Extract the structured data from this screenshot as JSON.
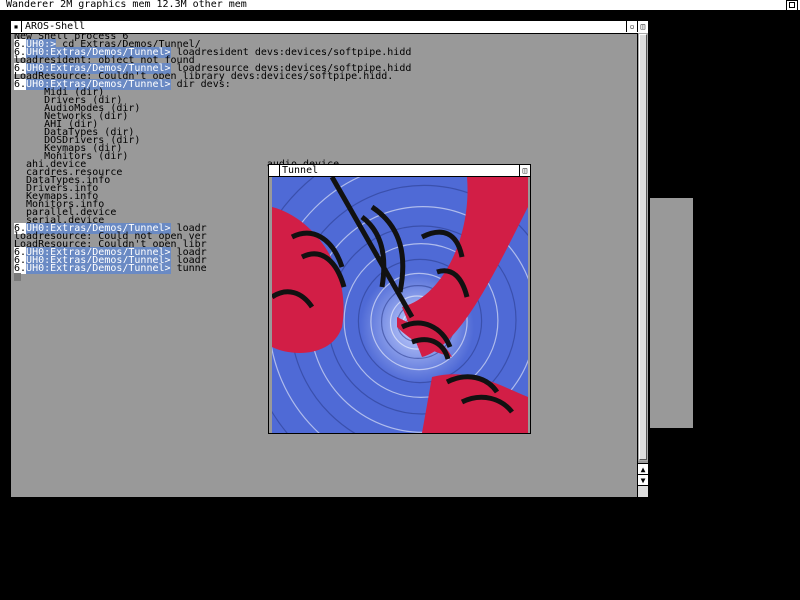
{
  "screen": {
    "title": "Wanderer 2M graphics mem 12.3M other mem"
  },
  "shell": {
    "title": "AROS-Shell",
    "close_glyph": "▪",
    "zoom_glyph": "▫",
    "depth_glyph": "◫",
    "up_glyph": "▲",
    "down_glyph": "▼",
    "lines": [
      {
        "type": "text",
        "text": "New Shell process 6"
      },
      {
        "type": "cmd",
        "num": "6.",
        "path": "UH0:>",
        "cmd": " cd Extras/Demos/Tunnel/"
      },
      {
        "type": "cmd",
        "num": "6.",
        "path": "UH0:Extras/Demos/Tunnel>",
        "cmd": " loadresident devs:devices/softpipe.hidd"
      },
      {
        "type": "text",
        "text": "loadresident: object not found"
      },
      {
        "type": "cmd",
        "num": "6.",
        "path": "UH0:Extras/Demos/Tunnel>",
        "cmd": " loadresource devs:devices/softpipe.hidd"
      },
      {
        "type": "text",
        "text": "LoadResource: Couldn't open library devs:devices/softpipe.hidd."
      },
      {
        "type": "cmd",
        "num": "6.",
        "path": "UH0:Extras/Demos/Tunnel>",
        "cmd": " dir devs:"
      },
      {
        "type": "text",
        "text": "     Midi (dir)"
      },
      {
        "type": "text",
        "text": "     Drivers (dir)"
      },
      {
        "type": "text",
        "text": "     AudioModes (dir)"
      },
      {
        "type": "text",
        "text": "     Networks (dir)"
      },
      {
        "type": "text",
        "text": "     AHI (dir)"
      },
      {
        "type": "text",
        "text": "     DataTypes (dir)"
      },
      {
        "type": "text",
        "text": "     DOSDrivers (dir)"
      },
      {
        "type": "text",
        "text": "     Keymaps (dir)"
      },
      {
        "type": "text",
        "text": "     Monitors (dir)"
      },
      {
        "type": "text",
        "text": "  ahi.device                              audio.device"
      },
      {
        "type": "text",
        "text": "  cardres.resource"
      },
      {
        "type": "text",
        "text": "  DataTypes.info"
      },
      {
        "type": "text",
        "text": "  Drivers.info"
      },
      {
        "type": "text",
        "text": "  Keymaps.info"
      },
      {
        "type": "text",
        "text": "  Monitors.info"
      },
      {
        "type": "text",
        "text": "  parallel.device"
      },
      {
        "type": "text",
        "text": "  serial.device"
      },
      {
        "type": "cmd",
        "num": "6.",
        "path": "UH0:Extras/Demos/Tunnel>",
        "cmd": " loadr                                     hidd"
      },
      {
        "type": "text",
        "text": "loadresource: Could not open ver                                    ium.hidd\"."
      },
      {
        "type": "text",
        "text": "LoadResource: Couldn't open libr"
      },
      {
        "type": "cmd",
        "num": "6.",
        "path": "UH0:Extras/Demos/Tunnel>",
        "cmd": " loadr"
      },
      {
        "type": "cmd",
        "num": "6.",
        "path": "UH0:Extras/Demos/Tunnel>",
        "cmd": " loadr                                     hidd"
      },
      {
        "type": "cmd",
        "num": "6.",
        "path": "UH0:Extras/Demos/Tunnel>",
        "cmd": " tunne"
      },
      {
        "type": "cursor"
      }
    ]
  },
  "tunnel": {
    "title": "Tunnel",
    "depth_glyph": "◫",
    "colors": {
      "blue": "#4f6ad6",
      "light": "#c8d4ff",
      "red": "#d21e46",
      "black": "#111111"
    }
  }
}
